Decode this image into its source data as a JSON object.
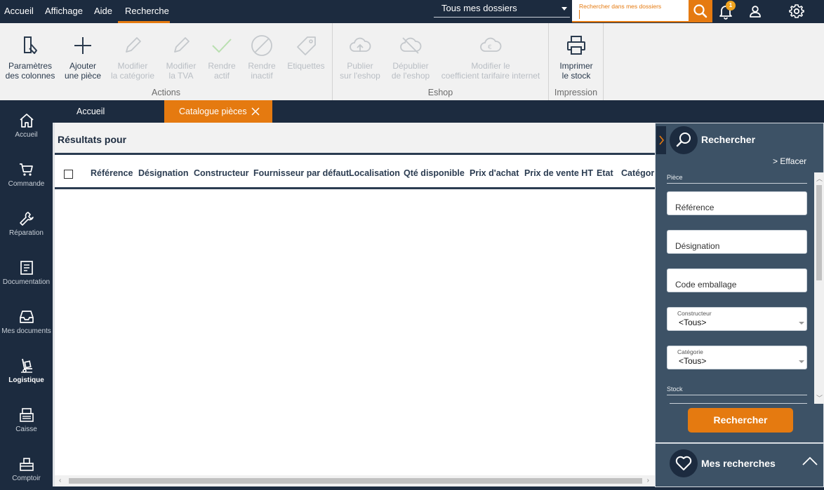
{
  "menu": {
    "items": [
      "Accueil",
      "Affichage",
      "Aide",
      "Recherche"
    ],
    "active": "Recherche"
  },
  "top": {
    "dossier": "Tous mes dossiers",
    "search_placeholder": "Rechercher dans mes dossiers",
    "notifications": "1"
  },
  "ribbon": {
    "actions_label": "Actions",
    "eshop_label": "Eshop",
    "impression_label": "Impression",
    "buttons": {
      "col_params": [
        "Paramètres",
        "des colonnes"
      ],
      "add_piece": [
        "Ajouter",
        "une pièce"
      ],
      "edit_category": [
        "Modifier",
        "la catégorie"
      ],
      "edit_tva": [
        "Modifier",
        "la TVA"
      ],
      "make_active": [
        "Rendre",
        "actif"
      ],
      "make_inactive": [
        "Rendre",
        "inactif"
      ],
      "labels": [
        "Etiquettes",
        ""
      ],
      "publish": [
        "Publier",
        "sur l'eshop"
      ],
      "unpublish": [
        "Dépublier",
        "de l'eshop"
      ],
      "edit_coef": [
        "Modifier le",
        "coefficient tarifaire internet"
      ],
      "print_stock": [
        "Imprimer",
        "le stock"
      ]
    }
  },
  "sidebar": {
    "items": [
      "Accueil",
      "Commande",
      "Réparation",
      "Documentation",
      "Mes documents",
      "Logistique",
      "Caisse",
      "Comptoir"
    ],
    "active": "Logistique"
  },
  "tabs": {
    "home": "Accueil",
    "catalogue": "Catalogue pièces"
  },
  "results": {
    "title": "Résultats pour",
    "columns": [
      "Référence",
      "Désignation",
      "Constructeur",
      "Fournisseur par défaut",
      "Localisation",
      "Qté disponible",
      "Prix d'achat",
      "Prix de vente HT",
      "Etat",
      "Catégori"
    ]
  },
  "search_panel": {
    "title": "Rechercher",
    "clear": "> Effacer",
    "section_piece": "Pièce",
    "reference_placeholder": "Référence",
    "designation_placeholder": "Désignation",
    "code_placeholder": "Code emballage",
    "constructeur_caption": "Constructeur",
    "constructeur_value": "<Tous>",
    "categorie_caption": "Catégorie",
    "categorie_value": "<Tous>",
    "section_stock": "Stock",
    "button": "Rechercher"
  },
  "saved_searches": {
    "title": "Mes recherches"
  },
  "colors": {
    "nav_dark": "#1c2b3f",
    "accent_orange": "#e57a10",
    "panel_blue": "#3d5266"
  }
}
